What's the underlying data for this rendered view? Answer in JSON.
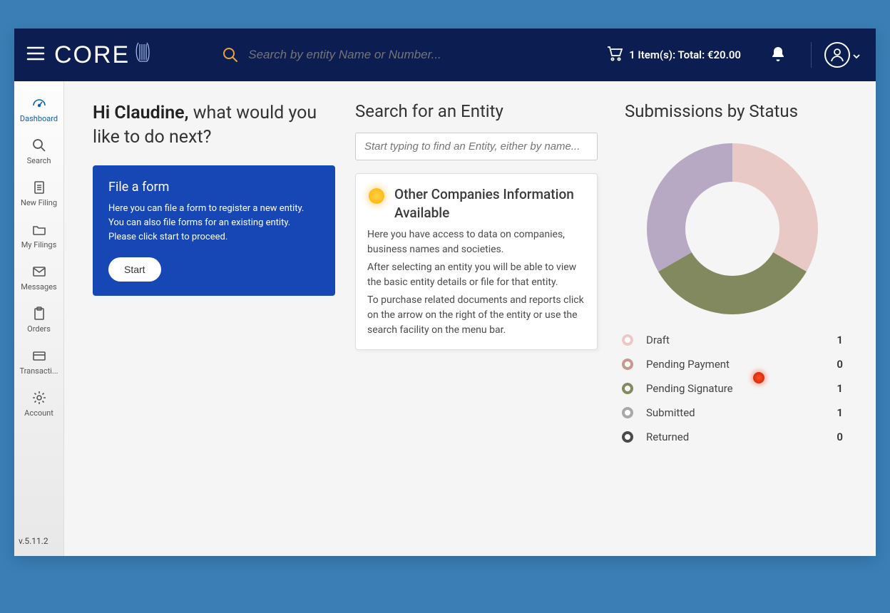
{
  "app": {
    "logo_text": "CORE"
  },
  "topbar": {
    "search_placeholder": "Search by entity Name or Number...",
    "cart_text": "1 Item(s): Total: €20.00"
  },
  "sidebar": {
    "items": [
      {
        "label": "Dashboard"
      },
      {
        "label": "Search"
      },
      {
        "label": "New Filing"
      },
      {
        "label": "My Filings"
      },
      {
        "label": "Messages"
      },
      {
        "label": "Orders"
      },
      {
        "label": "Transacti..."
      },
      {
        "label": "Account"
      }
    ],
    "version": "v.5.11.2"
  },
  "greeting": {
    "hello": "Hi Claudine,",
    "prompt": "what would you like to do next?"
  },
  "file_card": {
    "title": "File a form",
    "line1": "Here you can file a form to register a new entity.",
    "line2": "You can also file forms for an existing entity.",
    "line3": "Please click start to proceed.",
    "button": "Start"
  },
  "search_section": {
    "title": "Search for an Entity",
    "placeholder": "Start typing to find an Entity, either by name..."
  },
  "info_card": {
    "title": "Other Companies Information Available",
    "p1": "Here you have access to data on companies, business names and societies.",
    "p2": "After selecting an entity you will be able to view the basic entity details or file for that entity.",
    "p3": "To purchase related documents and reports click on the arrow on the right of the entity or use the search facility on the menu bar."
  },
  "submissions": {
    "title": "Submissions by Status",
    "legend": [
      {
        "label": "Draft",
        "count": 1,
        "color": "#e9c9c6"
      },
      {
        "label": "Pending Payment",
        "count": 0,
        "color": "#c79790"
      },
      {
        "label": "Pending Signature",
        "count": 1,
        "color": "#83895f"
      },
      {
        "label": "Submitted",
        "count": 1,
        "color": "#a9a9a9"
      },
      {
        "label": "Returned",
        "count": 0,
        "color": "#4a4a4a"
      }
    ]
  },
  "chart_data": {
    "type": "pie",
    "title": "Submissions by Status",
    "series": [
      {
        "name": "Draft",
        "value": 1,
        "color": "#e9c9c6"
      },
      {
        "name": "Pending Signature",
        "value": 1,
        "color": "#83895f"
      },
      {
        "name": "Submitted",
        "value": 1,
        "color": "#b7a8c4"
      }
    ],
    "donut_inner_ratio": 0.55
  }
}
